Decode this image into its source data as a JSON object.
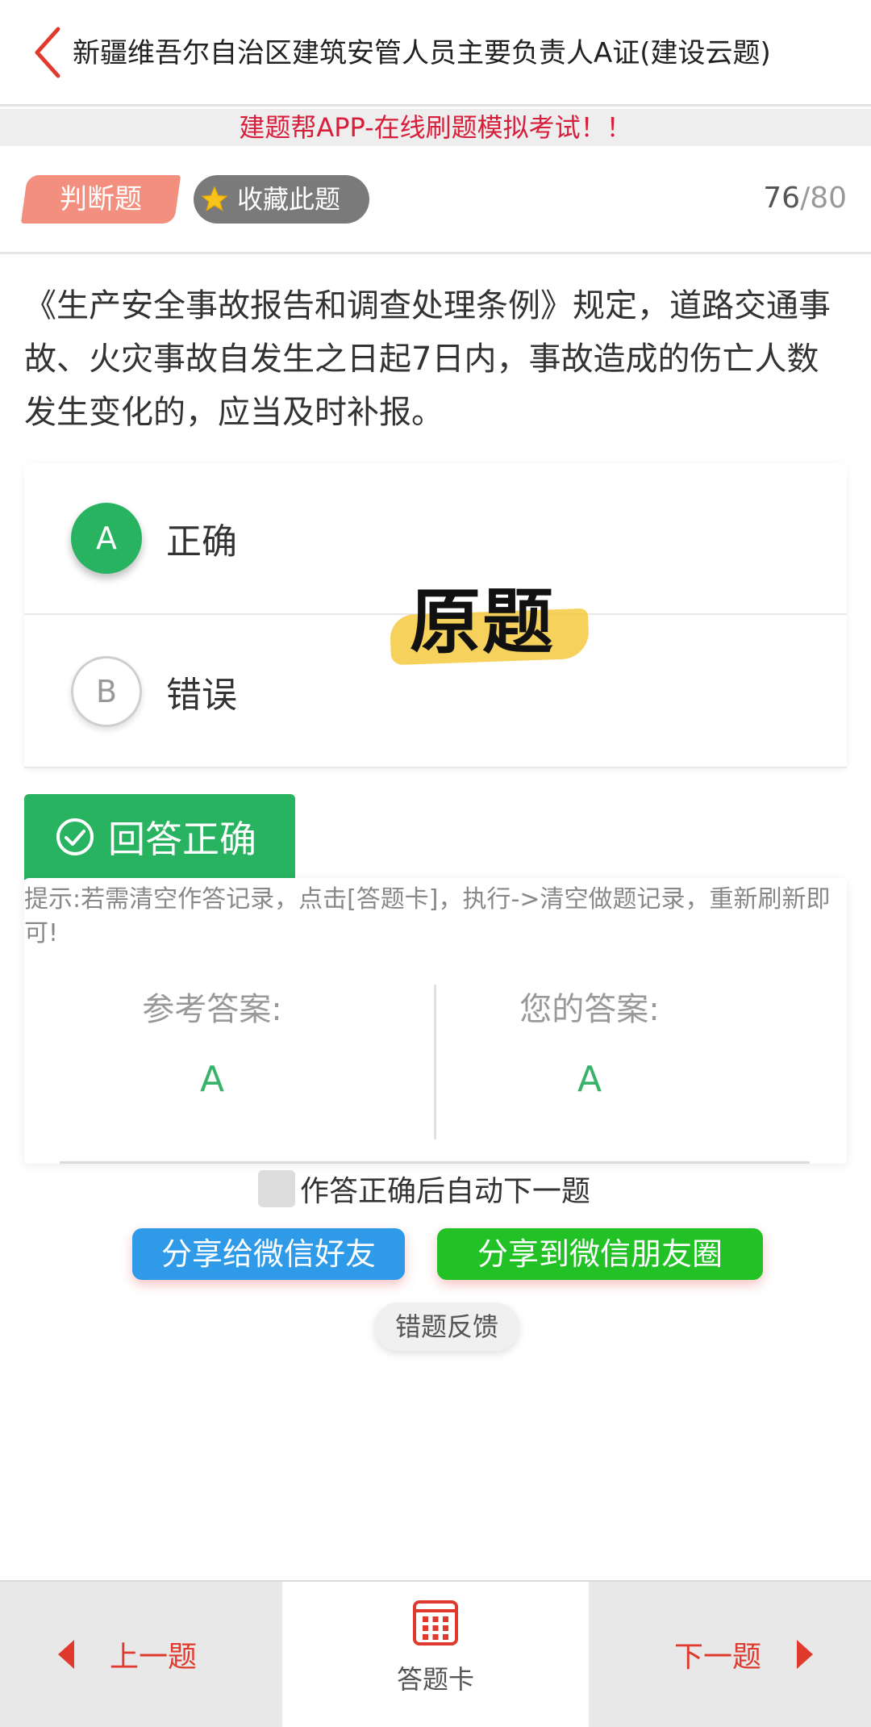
{
  "header": {
    "title": "新疆维吾尔自治区建筑安管人员主要负责人A证(建设云题)"
  },
  "promo": {
    "text": "建题帮APP-在线刷题模拟考试！！"
  },
  "question_meta": {
    "type": "判断题",
    "favorite_label": "收藏此题",
    "current": "76",
    "total": "/80"
  },
  "question": {
    "text": "《生产安全事故报告和调查处理条例》规定，道路交通事故、火灾事故自发生之日起7日内，事故造成的伤亡人数发生变化的，应当及时补报。"
  },
  "options": [
    {
      "letter": "A",
      "label": "正确",
      "selected": true
    },
    {
      "letter": "B",
      "label": "错误",
      "selected": false
    }
  ],
  "watermark": {
    "text": "原题"
  },
  "result": {
    "label": "回答正确"
  },
  "answer_panel": {
    "tip": "提示:若需清空作答记录，点击[答题卡]，执行->清空做题记录，重新刷新即可!",
    "reference_label": "参考答案:",
    "reference_value": "A",
    "your_label": "您的答案:",
    "your_value": "A"
  },
  "auto_next": {
    "label": "作答正确后自动下一题",
    "checked": false
  },
  "share": {
    "friend_label": "分享给微信好友",
    "moments_label": "分享到微信朋友圈"
  },
  "feedback": {
    "label": "错题反馈"
  },
  "footer": {
    "prev_label": "上一题",
    "card_label": "答题卡",
    "next_label": "下一题"
  },
  "colors": {
    "accent": "#e03a2e",
    "success": "#27b35f",
    "promo": "#d81e3a",
    "wechat_blue": "#2f9be8",
    "wechat_green": "#22c227"
  }
}
